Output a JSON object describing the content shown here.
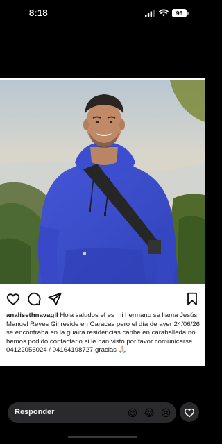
{
  "status_bar": {
    "time": "8:18",
    "battery_level": "96"
  },
  "post": {
    "username": "analisethnavagil",
    "caption": "Hola saludos el es mi hermano se llama Jesús Manuel Reyes Gil reside en Caracas pero el día de ayer 24/06/26 se encontraba en la guaira residencias caribe en caraballeda no hemos podido contactarlo si le han visto por favor comunicarse 04122056024 / 04164198727  gracias 🙏🏻"
  },
  "reply_bar": {
    "placeholder": "Responder",
    "quick_reactions": [
      "😍",
      "😂",
      "😢"
    ]
  },
  "colors": {
    "background": "#000000",
    "card": "#ffffff",
    "pill": "#2a2a2c",
    "hoodie": "#3c4fd0"
  }
}
